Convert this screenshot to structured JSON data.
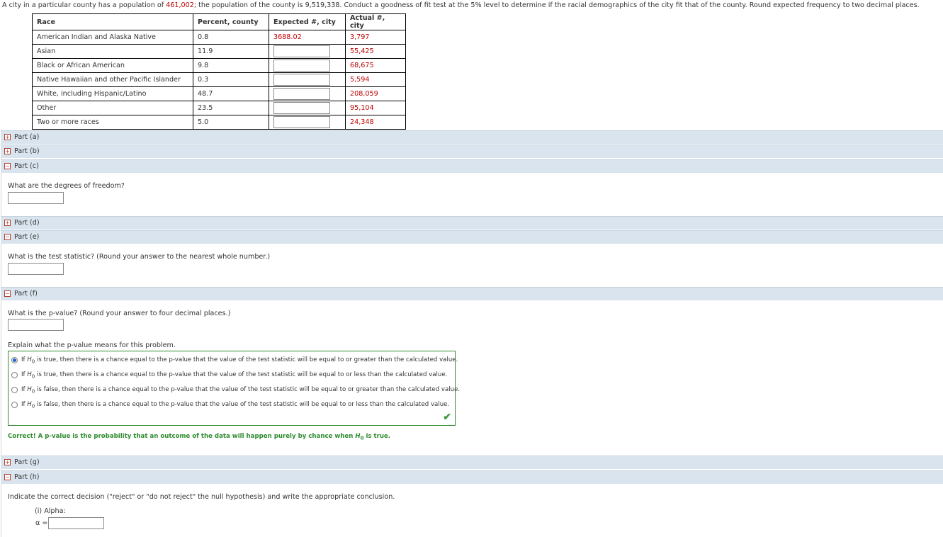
{
  "intro": {
    "part1": "A city in a particular county has a population of ",
    "city_pop": "461,002",
    "part2": "; the population of the county is 9,519,338. Conduct a goodness of fit test at the 5% level to determine if the racial demographics of the city fit that of the county. Round expected frequency to two decimal places."
  },
  "table": {
    "headers": [
      "Race",
      "Percent, county",
      "Expected #, city",
      "Actual #, city"
    ],
    "rows": [
      {
        "race": "American Indian and Alaska Native",
        "percent": "0.8",
        "expected": "3688.02",
        "actual": "3,797"
      },
      {
        "race": "Asian",
        "percent": "11.9",
        "expected": "",
        "actual": "55,425"
      },
      {
        "race": "Black or African American",
        "percent": "9.8",
        "expected": "",
        "actual": "68,675"
      },
      {
        "race": "Native Hawaiian and other Pacific Islander",
        "percent": "0.3",
        "expected": "",
        "actual": "5,594"
      },
      {
        "race": "White, including Hispanic/Latino",
        "percent": "48.7",
        "expected": "",
        "actual": "208,059"
      },
      {
        "race": "Other",
        "percent": "23.5",
        "expected": "",
        "actual": "95,104"
      },
      {
        "race": "Two or more races",
        "percent": "5.0",
        "expected": "",
        "actual": "24,348"
      }
    ]
  },
  "parts": {
    "a": {
      "label": "Part (a)",
      "toggle": "+"
    },
    "b": {
      "label": "Part (b)",
      "toggle": "+"
    },
    "c": {
      "label": "Part (c)",
      "toggle": "−"
    },
    "d": {
      "label": "Part (d)",
      "toggle": "+"
    },
    "e": {
      "label": "Part (e)",
      "toggle": "−"
    },
    "f": {
      "label": "Part (f)",
      "toggle": "−"
    },
    "g": {
      "label": "Part (g)",
      "toggle": "+"
    },
    "h": {
      "label": "Part (h)",
      "toggle": "−"
    }
  },
  "questions": {
    "c": "What are the degrees of freedom?",
    "e": "What is the test statistic? (Round your answer to the nearest whole number.)",
    "f_value": "What is the p-value? (Round your answer to four decimal places.)",
    "f_explain": "Explain what the p-value means for this problem.",
    "h": "Indicate the correct decision (\"reject\" or \"do not reject\" the null hypothesis) and write the appropriate conclusion.",
    "h_alpha": "(i) Alpha:",
    "h_alpha_symbol": "α ="
  },
  "choices": [
    {
      "hyp": "is true",
      "rest": ", then there is a chance equal to the p-value that the value of the test statistic will be equal to or greater than the calculated value.",
      "selected": true
    },
    {
      "hyp": "is true",
      "rest": ", then there is a chance equal to the p-value that the value of the test statistic will be equal to or less than the calculated value.",
      "selected": false
    },
    {
      "hyp": "is false",
      "rest": ", then there is a chance equal to the p-value that the value of the test statistic will be equal to or greater than the calculated value.",
      "selected": false
    },
    {
      "hyp": "is false",
      "rest": ", then there is a chance equal to the p-value that the value of the test statistic will be equal to or less than the calculated value.",
      "selected": false
    }
  ],
  "choice_prefix": "If ",
  "h0_symbol": "H",
  "h0_sub": "0",
  "feedback": {
    "text": "Correct! A p-value is the probability that an outcome of the data will happen purely by chance when ",
    "tail": " is true."
  },
  "colors": {
    "accent_red": "#c00000",
    "correct_green": "#2e8b2e",
    "part_bar": "#d9e4ee"
  },
  "icons": {
    "toggle": "square-plus-minus-icon",
    "correct": "checkmark-icon"
  }
}
